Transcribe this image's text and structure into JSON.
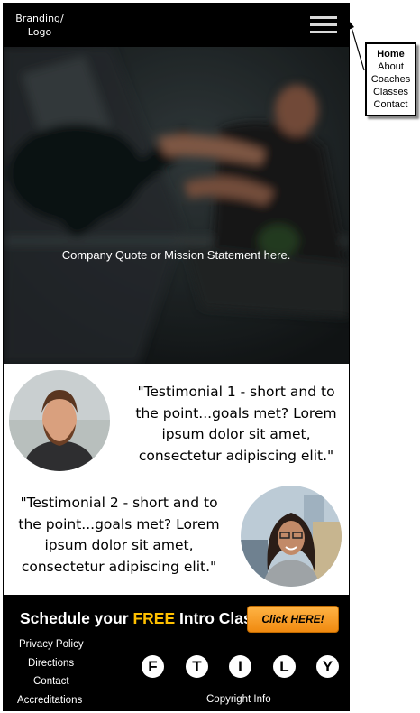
{
  "header": {
    "branding": "Branding/ Logo",
    "menu_icon": "hamburger-menu-icon"
  },
  "hero": {
    "statement": "Company Quote or Mission Statement here."
  },
  "testimonials": [
    {
      "text": "\"Testimonial 1 - short and to the point...goals met? Lorem ipsum dolor sit amet, consectetur adipiscing elit.\""
    },
    {
      "text": "\"Testimonial 2 - short and to the point...goals met? Lorem ipsum dolor sit amet, consectetur adipiscing elit.\""
    }
  ],
  "footer": {
    "cta": {
      "prefix": "Schedule your ",
      "highlight": "FREE",
      "suffix": " Intro Class:",
      "button": "Click HERE!"
    },
    "links": [
      "Privacy Policy",
      "Directions",
      "Contact",
      "Accreditations"
    ],
    "social": [
      "F",
      "T",
      "I",
      "L",
      "Y"
    ],
    "copyright": "Copyright Info"
  },
  "nav_menu": {
    "items": [
      "Home",
      "About",
      "Coaches",
      "Classes",
      "Contact"
    ]
  },
  "colors": {
    "cta_highlight": "#ffc000",
    "cta_button": "#f5a02a",
    "footer_bg": "#000000"
  }
}
